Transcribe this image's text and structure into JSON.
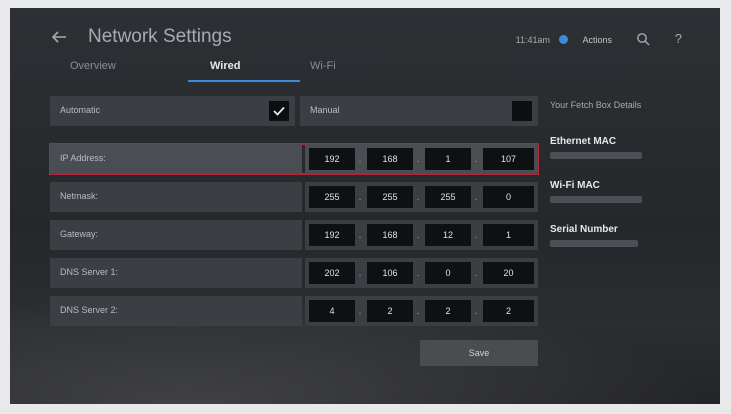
{
  "header": {
    "title": "Network Settings",
    "back_icon": "back-arrow-icon"
  },
  "tabs": [
    {
      "label": "Overview",
      "active": false
    },
    {
      "label": "Wired",
      "active": true
    },
    {
      "label": "Wi-Fi",
      "active": false
    }
  ],
  "status": {
    "time": "11:41am",
    "actions_label": "Actions",
    "search_icon": "search-icon",
    "help_label": "?"
  },
  "mode": {
    "automatic_label": "Automatic",
    "automatic_checked": true,
    "manual_label": "Manual",
    "manual_checked": false
  },
  "fields": [
    {
      "label": "IP Address:",
      "octets": [
        "192",
        "168",
        "1",
        "107"
      ],
      "selected": true
    },
    {
      "label": "Netmask:",
      "octets": [
        "255",
        "255",
        "255",
        "0"
      ],
      "selected": false
    },
    {
      "label": "Gateway:",
      "octets": [
        "192",
        "168",
        "12",
        "1"
      ],
      "selected": false
    },
    {
      "label": "DNS Server 1:",
      "octets": [
        "202",
        "106",
        "0",
        "20"
      ],
      "selected": false
    },
    {
      "label": "DNS Server 2:",
      "octets": [
        "4",
        "2",
        "2",
        "2"
      ],
      "selected": false
    }
  ],
  "save_label": "Save",
  "details": {
    "heading": "Your Fetch Box Details",
    "ethernet_mac_label": "Ethernet MAC",
    "ethernet_mac_value": "",
    "wifi_mac_label": "Wi-Fi MAC",
    "wifi_mac_value": "",
    "serial_label": "Serial Number",
    "serial_value": ""
  },
  "colors": {
    "accent": "#3f8ad8",
    "selection": "#b3263a"
  }
}
